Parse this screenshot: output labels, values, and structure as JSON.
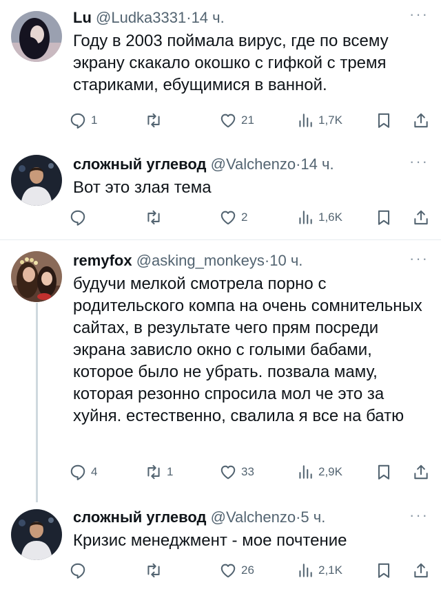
{
  "tweets": [
    {
      "name": "Lu",
      "handle": "@Ludka3331",
      "dot": "·",
      "time": "14 ч.",
      "text": "Году в 2003 поймала вирус, где по всему экрану скакало окошко с гифкой с тремя стариками, ебущимися в ванной.",
      "replies": "1",
      "retweets": "",
      "likes": "21",
      "views": "1,7K",
      "avatar": "woman-dark-hair"
    },
    {
      "name": "сложный углевод",
      "handle": "@Valchenzo",
      "dot": "·",
      "time": "14 ч.",
      "text": "Вот это злая тема",
      "replies": "",
      "retweets": "",
      "likes": "2",
      "views": "1,6K",
      "avatar": "man-white-shirt"
    },
    {
      "name": "remyfox",
      "handle": "@asking_monkeys",
      "dot": "·",
      "time": "10 ч.",
      "text": "будучи мелкой смотрела порно с родительского компа на очень сомнительных сайтах, в результате чего прям посреди экрана зависло окно с голыми бабами, которое было не убрать. позвала маму, которая резонно спросила мол че это за хуйня. естественно, свалила я все на батю",
      "replies": "4",
      "retweets": "1",
      "likes": "33",
      "views": "2,9K",
      "avatar": "two-girls-flower-crown"
    },
    {
      "name": "сложный углевод",
      "handle": "@Valchenzo",
      "dot": "·",
      "time": "5 ч.",
      "text": "Кризис менеджмент - мое почтение",
      "replies": "",
      "retweets": "",
      "likes": "26",
      "views": "2,1K",
      "avatar": "man-white-shirt"
    }
  ],
  "icons": {
    "reply": "reply-icon",
    "retweet": "retweet-icon",
    "like": "like-icon",
    "views": "views-icon",
    "bookmark": "bookmark-icon",
    "share": "share-icon",
    "more": "more-icon"
  },
  "colors": {
    "text": "#0f1419",
    "secondary": "#536471",
    "thread_line": "#cfd9de",
    "divider": "#e6ecf0"
  }
}
